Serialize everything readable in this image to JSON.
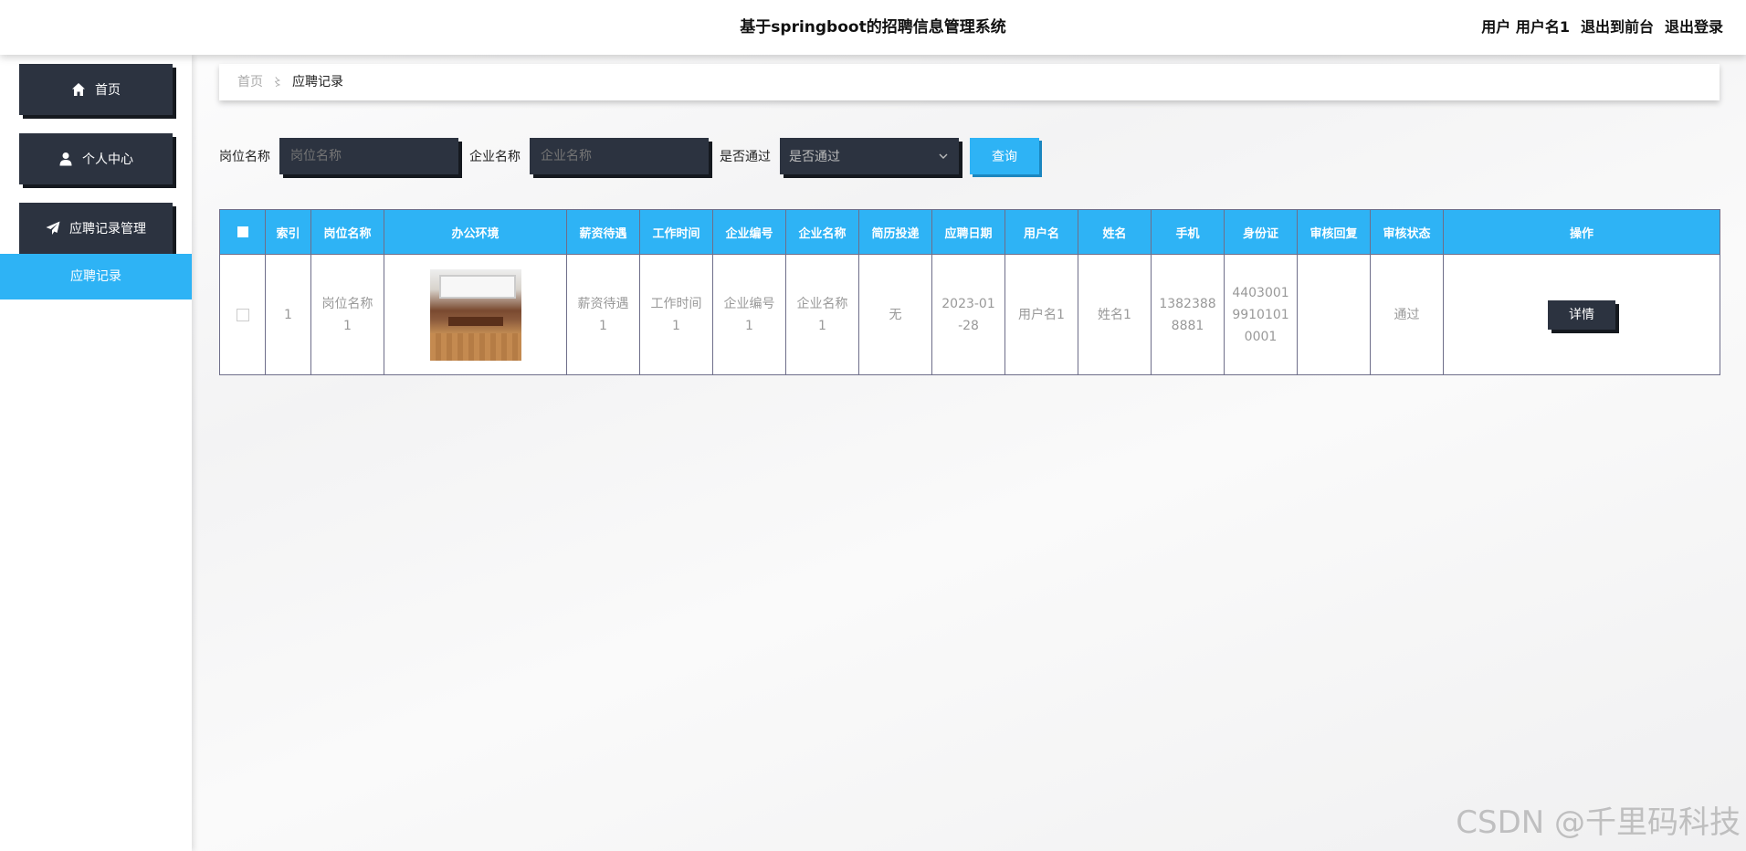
{
  "header": {
    "title": "基于springboot的招聘信息管理系统",
    "user_role": "用户",
    "username": "用户名1",
    "back_to_front": "退出到前台",
    "logout": "退出登录"
  },
  "sidebar": {
    "items": [
      {
        "label": "首页",
        "icon": "home-icon"
      },
      {
        "label": "个人中心",
        "icon": "user-icon"
      },
      {
        "label": "应聘记录管理",
        "icon": "paper-plane-icon"
      }
    ],
    "sub_item": "应聘记录"
  },
  "breadcrumb": {
    "home": "首页",
    "separator": "〻",
    "current": "应聘记录"
  },
  "search": {
    "job_label": "岗位名称",
    "job_placeholder": "岗位名称",
    "company_label": "企业名称",
    "company_placeholder": "企业名称",
    "pass_label": "是否通过",
    "pass_value": "是否通过",
    "query_button": "查询"
  },
  "table": {
    "headers": [
      "索引",
      "岗位名称",
      "办公环境",
      "薪资待遇",
      "工作时间",
      "企业编号",
      "企业名称",
      "简历投递",
      "应聘日期",
      "用户名",
      "姓名",
      "手机",
      "身份证",
      "审核回复",
      "审核状态",
      "操作"
    ],
    "rows": [
      {
        "index": "1",
        "job_name": "岗位名称1",
        "salary": "薪资待遇1",
        "work_time": "工作时间1",
        "company_no": "企业编号1",
        "company_name": "企业名称1",
        "resume": "无",
        "apply_date": "2023-01-28",
        "username": "用户名1",
        "name": "姓名1",
        "phone": "13823888881",
        "id_card": "440300199101010001",
        "review_reply": "",
        "review_status": "通过",
        "action": "详情"
      }
    ]
  },
  "watermark": "CSDN @千里码科技",
  "colors": {
    "accent": "#2eb3f5",
    "dark": "#2c3340"
  }
}
